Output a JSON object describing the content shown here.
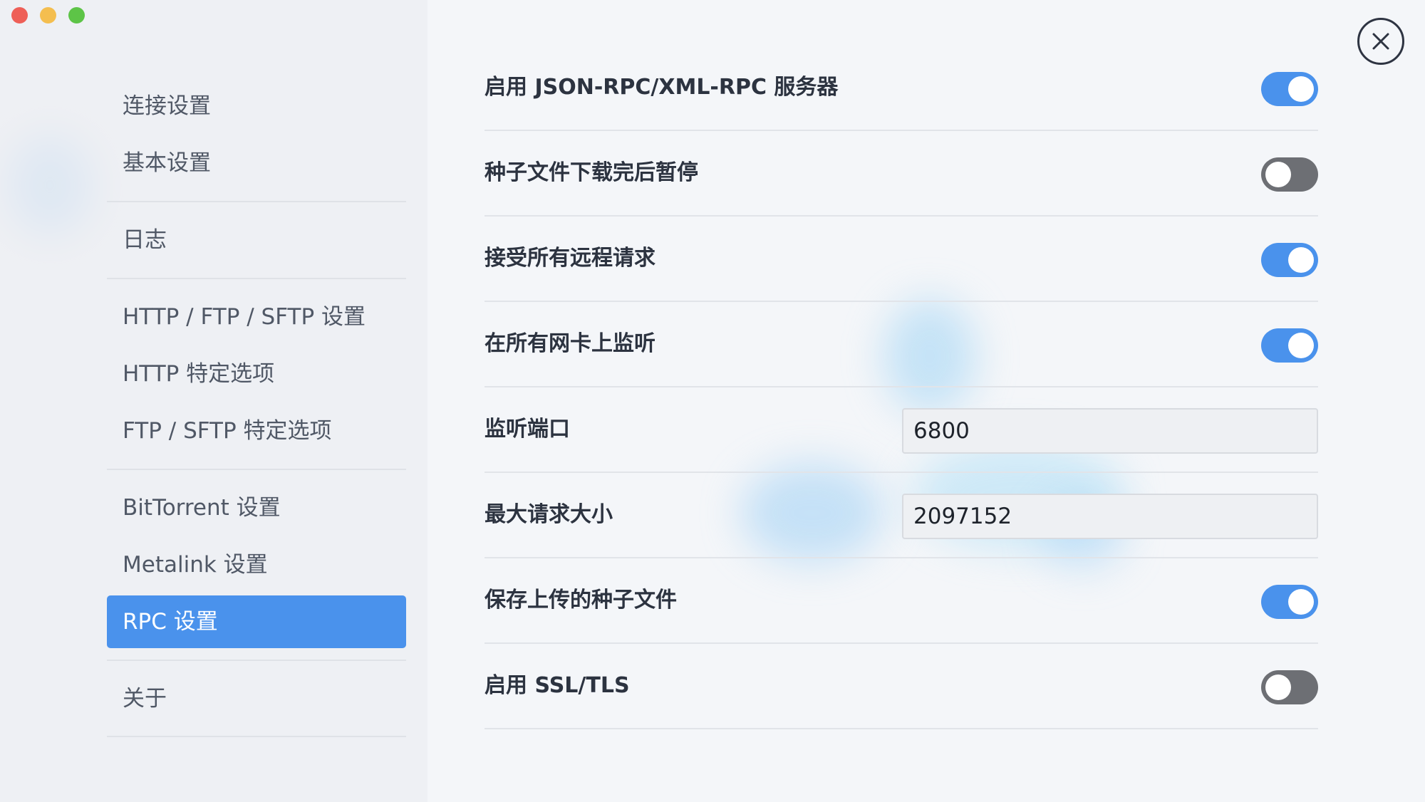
{
  "window": {
    "controls": [
      "close-window",
      "minimize-window",
      "zoom-window"
    ]
  },
  "sidebar": {
    "items": [
      {
        "label": "连接设置"
      },
      {
        "label": "基本设置"
      },
      {
        "label": "日志"
      },
      {
        "label": "HTTP / FTP / SFTP 设置"
      },
      {
        "label": "HTTP 特定选项"
      },
      {
        "label": "FTP / SFTP 特定选项"
      },
      {
        "label": "BitTorrent 设置"
      },
      {
        "label": "Metalink 设置"
      },
      {
        "label": "RPC 设置",
        "active": true
      },
      {
        "label": "关于"
      }
    ]
  },
  "main": {
    "close_icon": "close-circle-icon",
    "settings": [
      {
        "label": "启用 JSON-RPC/XML-RPC 服务器",
        "type": "toggle",
        "value": true
      },
      {
        "label": "种子文件下载完后暂停",
        "type": "toggle",
        "value": false
      },
      {
        "label": "接受所有远程请求",
        "type": "toggle",
        "value": true
      },
      {
        "label": "在所有网卡上监听",
        "type": "toggle",
        "value": true
      },
      {
        "label": "监听端口",
        "type": "text",
        "value": "6800"
      },
      {
        "label": "最大请求大小",
        "type": "text",
        "value": "2097152"
      },
      {
        "label": "保存上传的种子文件",
        "type": "toggle",
        "value": true
      },
      {
        "label": "启用 SSL/TLS",
        "type": "toggle",
        "value": false
      }
    ]
  },
  "colors": {
    "accent": "#4a92ec",
    "toggle_off": "#6d6f74",
    "close_red": "#ee5f57",
    "minimize_yellow": "#f4be4f",
    "zoom_green": "#5dc447"
  }
}
